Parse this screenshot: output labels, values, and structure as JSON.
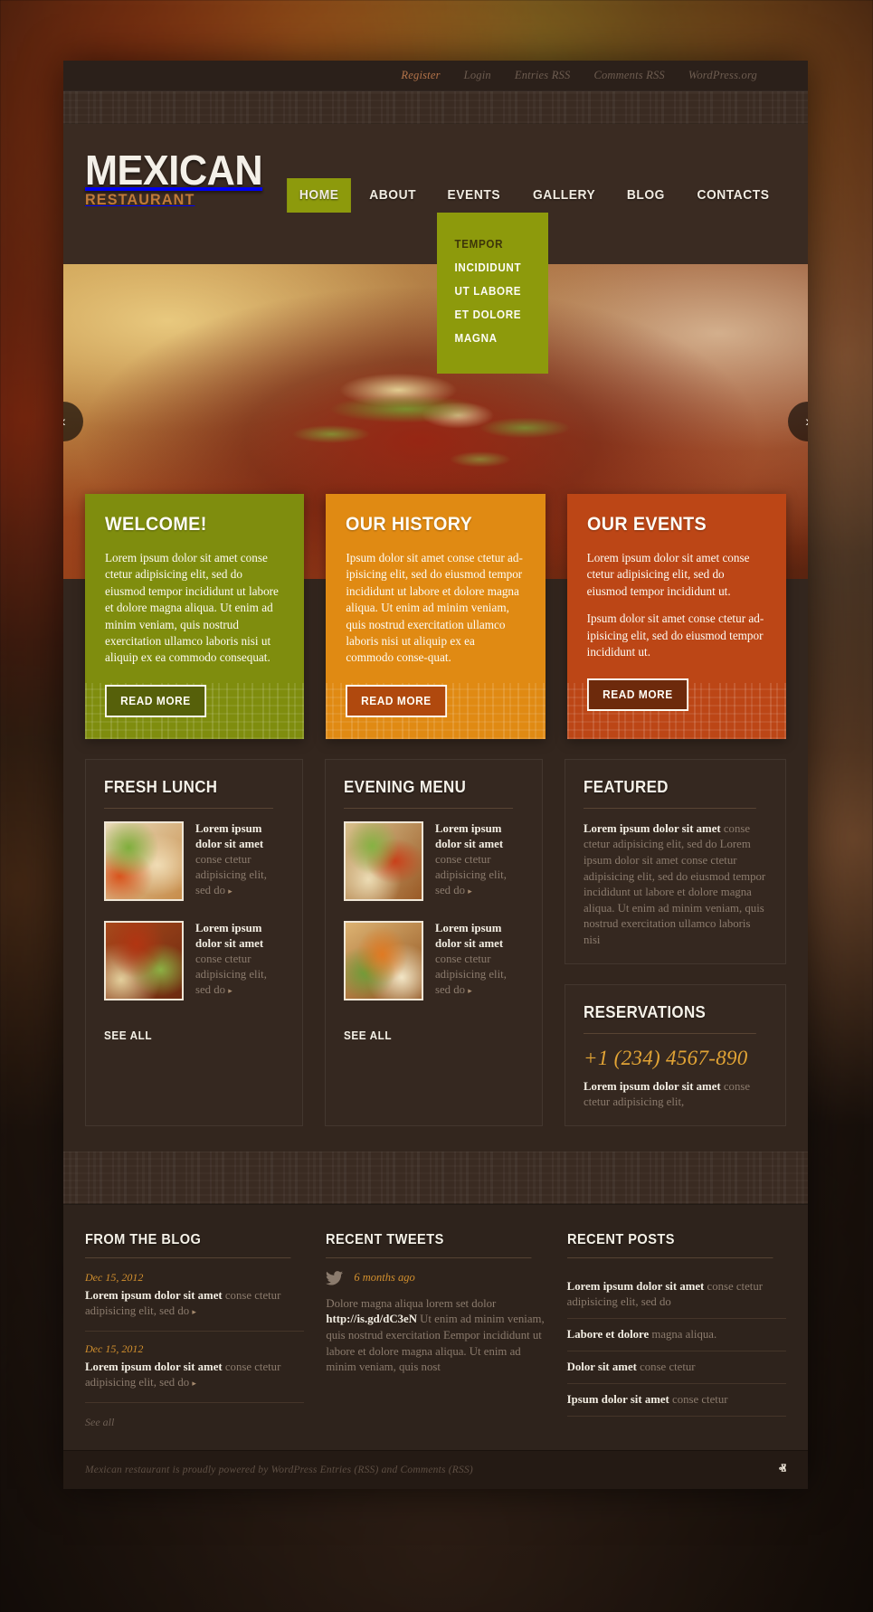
{
  "topbar": {
    "links": [
      {
        "label": "Register",
        "accent": true
      },
      {
        "label": "Login",
        "accent": false
      },
      {
        "label": "Entries RSS",
        "accent": false
      },
      {
        "label": "Comments RSS",
        "accent": false
      },
      {
        "label": "WordPress.org",
        "accent": false
      }
    ]
  },
  "header": {
    "logo_main": "MEXICAN",
    "logo_sub": "RESTAURANT",
    "nav": [
      {
        "label": "HOME",
        "active": true
      },
      {
        "label": "ABOUT",
        "active": false
      },
      {
        "label": "EVENTS",
        "active": false
      },
      {
        "label": "GALLERY",
        "active": false
      },
      {
        "label": "BLOG",
        "active": false
      },
      {
        "label": "CONTACTS",
        "active": false
      }
    ],
    "dropdown": [
      "TEMPOR",
      "INCIDIDUNT",
      "UT LABORE",
      "ET DOLORE",
      "MAGNA"
    ]
  },
  "hero": {
    "prev_icon": "‹",
    "next_icon": "›"
  },
  "promos": [
    {
      "title": "WELCOME!",
      "paragraphs": [
        "Lorem ipsum dolor sit amet conse ctetur adipisicing elit, sed do eiusmod tempor incididunt ut labore et dolore magna aliqua. Ut enim ad minim veniam, quis nostrud exercitation ullamco laboris nisi ut aliquip ex ea commodo consequat."
      ],
      "button": "READ MORE",
      "color": "#7f8d0e"
    },
    {
      "title": "OUR HISTORY",
      "paragraphs": [
        "Ipsum dolor sit amet conse ctetur ad-ipisicing elit, sed do eiusmod tempor incididunt ut labore et dolore magna aliqua. Ut enim ad minim veniam, quis nostrud exercitation ullamco laboris nisi ut aliquip ex ea commodo conse-quat."
      ],
      "button": "READ MORE",
      "color": "#e08a13"
    },
    {
      "title": "OUR EVENTS",
      "paragraphs": [
        "Lorem ipsum dolor sit amet conse ctetur adipisicing elit, sed do eiusmod tempor incididunt ut.",
        "Ipsum dolor sit amet conse ctetur ad-ipisicing elit, sed do eiusmod tempor incididunt ut."
      ],
      "button": "READ MORE",
      "color": "#bc4616"
    }
  ],
  "fresh_lunch": {
    "title": "FRESH LUNCH",
    "items": [
      {
        "title": "Lorem ipsum dolor sit amet",
        "desc": "conse ctetur adipisicing elit, sed do",
        "arrow": "▸"
      },
      {
        "title": "Lorem ipsum dolor sit amet",
        "desc": "conse ctetur adipisicing elit, sed do",
        "arrow": "▸"
      }
    ],
    "see_all": "SEE ALL"
  },
  "evening_menu": {
    "title": "EVENING MENU",
    "items": [
      {
        "title": "Lorem ipsum dolor sit amet",
        "desc": "conse ctetur adipisicing elit, sed do",
        "arrow": "▸"
      },
      {
        "title": "Lorem ipsum dolor sit amet",
        "desc": "conse ctetur adipisicing elit, sed do",
        "arrow": "▸"
      }
    ],
    "see_all": "SEE ALL"
  },
  "featured": {
    "title": "FEATURED",
    "lead": "Lorem ipsum dolor sit amet",
    "body": " conse ctetur adipisicing elit, sed do Lorem ipsum dolor sit amet conse ctetur adipisicing elit, sed do eiusmod tempor incididunt ut labore et dolore magna aliqua. Ut enim ad minim veniam, quis nostrud exercitation ullamco laboris nisi"
  },
  "reservations": {
    "title": "RESERVATIONS",
    "phone": "+1 (234) 4567-890",
    "lead": "Lorem ipsum dolor sit amet",
    "body": " conse ctetur adipisicing elit,"
  },
  "footer": {
    "blog": {
      "title": "FROM THE BLOG",
      "entries": [
        {
          "date": "Dec 15, 2012",
          "lead": "Lorem ipsum dolor sit amet",
          "rest": " conse ctetur adipisicing elit, sed do",
          "arrow": "▸"
        },
        {
          "date": "Dec 15, 2012",
          "lead": "Lorem ipsum dolor sit amet",
          "rest": " conse ctetur adipisicing elit, sed do",
          "arrow": "▸"
        }
      ],
      "see_all": "See all"
    },
    "tweets": {
      "title": "RECENT TWEETS",
      "time": "6 months ago",
      "text_before": "Dolore magna aliqua lorem set dolor ",
      "link": "http://is.gd/dC3eN",
      "text_after": " Ut enim ad minim veniam, quis nostrud exercitation  Eempor incididunt ut labore et dolore magna aliqua. Ut enim ad minim veniam, quis nost"
    },
    "posts": {
      "title": "RECENT POSTS",
      "items": [
        {
          "lead": "Lorem ipsum dolor sit amet",
          "rest": " conse ctetur adipisicing elit, sed do"
        },
        {
          "lead": "Labore et dolore",
          "rest": " magna aliqua."
        },
        {
          "lead": "Dolor sit amet",
          "rest": " conse ctetur"
        },
        {
          "lead": "Ipsum dolor sit amet",
          "rest": " conse ctetur"
        }
      ]
    }
  },
  "copyright": {
    "text": "Mexican restaurant  is proudly powered by WordPress  Entries (RSS) and Comments (RSS)",
    "to_top_icon": "ⱏ"
  }
}
